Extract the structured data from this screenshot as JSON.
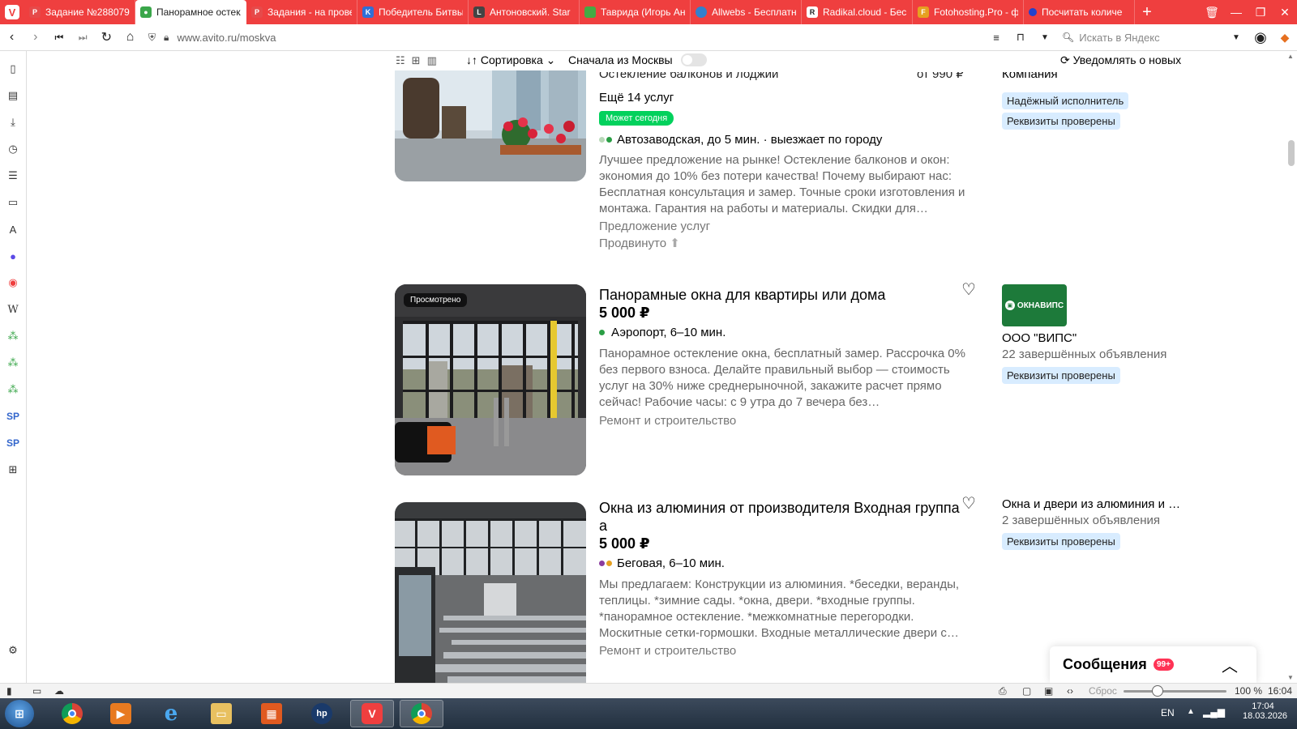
{
  "browser": {
    "tabs": [
      {
        "label": "Задание №288079",
        "fav": "pikabu-icon",
        "color": "#e64a4a"
      },
      {
        "label": "Панорамное остекление",
        "fav": "avito-icon",
        "color": "#3aa64a",
        "active": true
      },
      {
        "label": "Задания - на проверку",
        "fav": "pikabu-icon",
        "color": "#e64a4a"
      },
      {
        "label": "Победитель Битвы",
        "fav": "vk-icon",
        "color": "#2f6fd6"
      },
      {
        "label": "Антоновский. Star",
        "fav": "site-icon",
        "color": "#444444"
      },
      {
        "label": "Таврида (Игорь Ан",
        "fav": "site-icon",
        "color": "#44aa44"
      },
      {
        "label": "Allwebs - Бесплатн",
        "fav": "globe-icon",
        "color": "#3380cc"
      },
      {
        "label": "Radikal.cloud - Бес",
        "fav": "radikal-icon",
        "color": "#222222"
      },
      {
        "label": "Fotohosting.Pro - ф",
        "fav": "fotohosting-icon",
        "color": "#e6a020"
      },
      {
        "label": "Посчитать количе",
        "fav": "dot-icon",
        "color": "#2242cc"
      }
    ],
    "url": "www.avito.ru/moskva",
    "search_placeholder": "Искать в Яндекс",
    "accent": "#ef3f3f"
  },
  "sortbar": {
    "sort_label": "↓↑ Сортировка ⌄",
    "moscow_first_label": "Сначала из Москвы",
    "moscow_first_on": false,
    "notify_label": "Уведомлять о новых"
  },
  "listings": [
    {
      "cutoff_title": "Остекление балконов и лоджий",
      "cutoff_price": "от 990 ₽",
      "more_services": "Ещё 14 услуг",
      "urgent_badge": "Может сегодня",
      "metro": "Автозаводская, до 5 мин. · выезжает по городу",
      "description": "Лучшее предложение на рынке! Остекление балконов и окон: экономия до 10% без потери качества! Почему выбирают нас: Бесплатная консультация и замер. Точные сроки изготовления и монтажа. Гарантия на работы и материалы. Скидки для…",
      "category": "Предложение услуг",
      "promoted": "Продвинуто",
      "seller_cutoff": "Компания",
      "seller_tags": [
        "Надёжный исполнитель",
        "Реквизиты проверены"
      ]
    },
    {
      "viewed_badge": "Просмотрено",
      "title": "Панорамные окна для квартиры или дома",
      "price": "5 000 ₽",
      "metro": "Аэропорт, 6–10 мин.",
      "description": "Панорамное остекление окна, бесплатный замер. Рассрочка 0% без первого взноса. Делайте правильный выбор — стоимость услуг на 30% ниже среднерыночной, закажите расчет прямо сейчас! Рабочие часы: с 9 утра до 7 вечера без…",
      "category": "Ремонт и строительство",
      "seller_logo_text": "ОКНАВИПС",
      "seller_name": "ООО \"ВИПС\"",
      "seller_count": "22 завершённых объявления",
      "seller_tags": [
        "Реквизиты проверены"
      ]
    },
    {
      "title": "Окна из алюминия от производителя Входная группа а",
      "price": "5 000 ₽",
      "metro": "Беговая, 6–10 мин.",
      "description": "Мы предлагаем: Конструкции из алюминия. *беседки, веранды, теплицы. *зимние сады. *окна, двери. *входные группы. *панорамное остекление. *межкомнатные перегородки. Москитные сетки-гормошки. Входные металлические двери с…",
      "category": "Ремонт и строительство",
      "seller_name": "Окна и двери из алюминия и …",
      "seller_count": "2 завершённых объявления",
      "seller_tags": [
        "Реквизиты проверены"
      ]
    }
  ],
  "messages": {
    "title": "Сообщения",
    "badge": "99+"
  },
  "statusbar": {
    "zoom_reset": "Сброс",
    "zoom": "100 %",
    "time": "16:04",
    "zoom_level": 100
  },
  "taskbar": {
    "lang": "EN",
    "time": "17:04",
    "date": "18.03.2026",
    "apps": [
      "chrome-icon",
      "media-player-icon",
      "internet-explorer-icon",
      "file-explorer-icon",
      "control-panel-icon",
      "hp-icon",
      "vivaldi-icon",
      "chrome-icon"
    ]
  }
}
